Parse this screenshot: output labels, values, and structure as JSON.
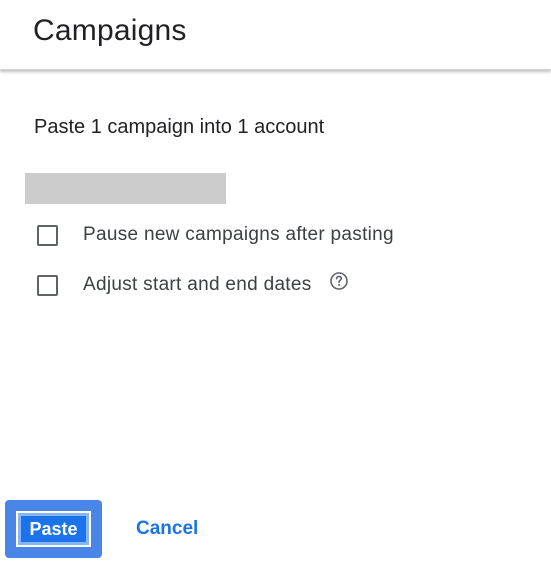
{
  "dialog": {
    "title": "Campaigns",
    "subtitle": "Paste 1 campaign into 1 account",
    "options": [
      {
        "label": "Pause new campaigns after pasting",
        "checked": false
      },
      {
        "label": "Adjust start and end dates",
        "checked": false,
        "icon": "help-circle-icon"
      }
    ],
    "buttons": {
      "paste": "Paste",
      "cancel": "Cancel"
    },
    "colors": {
      "primary": "#1a73e8",
      "redacted": "#cccccc"
    }
  }
}
